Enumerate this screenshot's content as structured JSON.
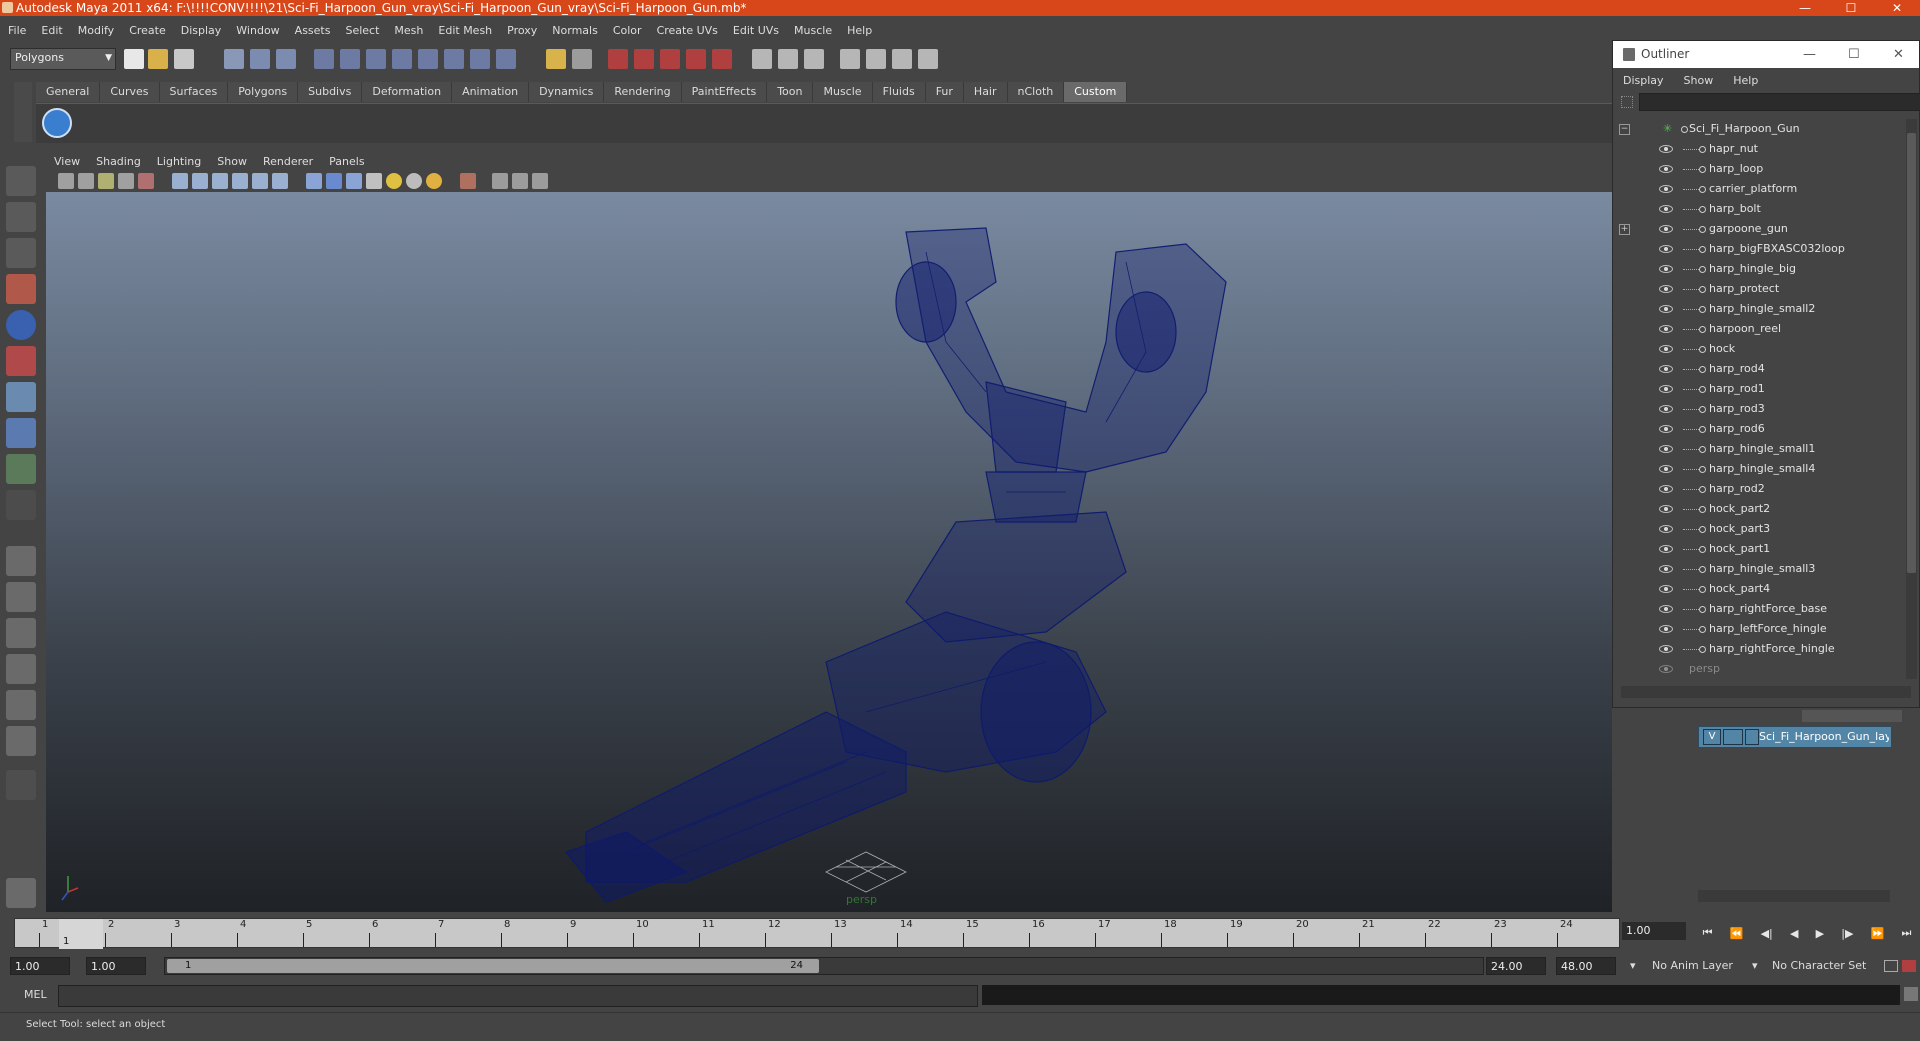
{
  "window": {
    "title": "Autodesk Maya 2011 x64: F:\\!!!!CONV!!!!\\21\\Sci-Fi_Harpoon_Gun_vray\\Sci-Fi_Harpoon_Gun_vray\\Sci-Fi_Harpoon_Gun.mb*",
    "controls": [
      "—",
      "☐",
      "✕"
    ]
  },
  "menubar": [
    "File",
    "Edit",
    "Modify",
    "Create",
    "Display",
    "Window",
    "Assets",
    "Select",
    "Mesh",
    "Edit Mesh",
    "Proxy",
    "Normals",
    "Color",
    "Create UVs",
    "Edit UVs",
    "Muscle",
    "Help"
  ],
  "statusline": {
    "mode_select": "Polygons"
  },
  "shelf": {
    "tabs": [
      "General",
      "Curves",
      "Surfaces",
      "Polygons",
      "Subdivs",
      "Deformation",
      "Animation",
      "Dynamics",
      "Rendering",
      "PaintEffects",
      "Toon",
      "Muscle",
      "Fluids",
      "Fur",
      "Hair",
      "nCloth",
      "Custom"
    ],
    "active_tab": "Custom"
  },
  "viewport": {
    "menu": [
      "View",
      "Shading",
      "Lighting",
      "Show",
      "Renderer",
      "Panels"
    ],
    "camera_label": "persp",
    "wire_color": "#0d1a6e"
  },
  "outliner": {
    "title": "Outliner",
    "controls": [
      "—",
      "☐",
      "✕"
    ],
    "menu": [
      "Display",
      "Show",
      "Help"
    ],
    "root": "Sci_Fi_Harpoon_Gun",
    "items": [
      "hapr_nut",
      "harp_loop",
      "carrier_platform",
      "harp_bolt",
      "garpoone_gun",
      "harp_bigFBXASC032loop",
      "harp_hingle_big",
      "harp_protect",
      "harp_hingle_small2",
      "harpoon_reel",
      "hock",
      "harp_rod4",
      "harp_rod1",
      "harp_rod3",
      "harp_rod6",
      "harp_hingle_small1",
      "harp_hingle_small4",
      "harp_rod2",
      "hock_part2",
      "hock_part3",
      "hock_part1",
      "harp_hingle_small3",
      "hock_part4",
      "harp_rightForce_base",
      "harp_leftForce_hingle",
      "harp_rightForce_hingle"
    ],
    "camera_item": "persp"
  },
  "layers": {
    "visible_flag": "V",
    "layer_name": "Sci_Fi_Harpoon_Gun_layer"
  },
  "timeline": {
    "ticks": [
      "1",
      "2",
      "3",
      "4",
      "5",
      "6",
      "7",
      "8",
      "9",
      "10",
      "11",
      "12",
      "13",
      "14",
      "15",
      "16",
      "17",
      "18",
      "19",
      "20",
      "21",
      "22",
      "23",
      "24"
    ],
    "current_frame": "1",
    "current_frame_field": "1.00",
    "playback_buttons": [
      "⏮",
      "⏪",
      "◀|",
      "◀",
      "▶",
      "|▶",
      "⏩",
      "⏭"
    ]
  },
  "range": {
    "start_field": "1.00",
    "start2_field": "1.00",
    "thumb_start": "1",
    "thumb_end": "24",
    "end_field": "24.00",
    "end2_field": "48.00",
    "anim_layer": "No Anim Layer",
    "char_set": "No Character Set"
  },
  "cmdline": {
    "label": "MEL"
  },
  "helpline": {
    "text": "Select Tool: select an object"
  }
}
